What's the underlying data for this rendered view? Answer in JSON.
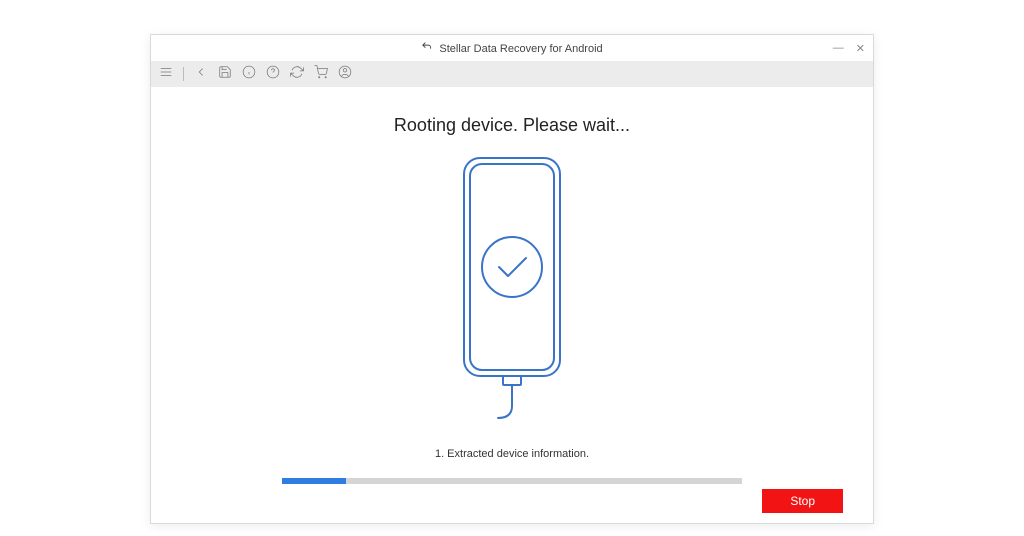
{
  "titlebar": {
    "title": "Stellar Data Recovery for Android"
  },
  "toolbar": {
    "icon_menu": "menu-icon",
    "icon_back": "back-icon",
    "icon_save": "save-icon",
    "icon_info": "info-icon",
    "icon_help": "help-icon",
    "icon_refresh": "refresh-icon",
    "icon_cart": "cart-icon",
    "icon_user": "user-icon"
  },
  "main": {
    "heading": "Rooting device. Please wait...",
    "status_line": "1. Extracted device information.",
    "progress_percent": 14
  },
  "actions": {
    "stop_label": "Stop"
  },
  "colors": {
    "accent": "#2f7de1",
    "danger": "#f21414",
    "outline": "#3a74c8"
  }
}
